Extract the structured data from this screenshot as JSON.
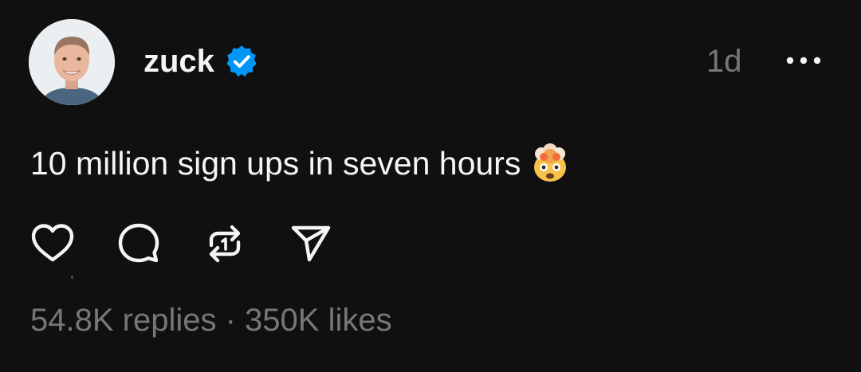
{
  "post": {
    "author": {
      "username": "zuck",
      "verified_icon": "verified-badge-icon",
      "avatar": "profile-photo"
    },
    "timestamp": "1d",
    "more_icon": "more-horizontal-icon",
    "text": "10 million sign ups in seven hours",
    "emoji": "exploding-head-emoji",
    "actions": [
      {
        "icon": "heart-icon"
      },
      {
        "icon": "comment-icon"
      },
      {
        "icon": "repost-icon"
      },
      {
        "icon": "share-send-icon"
      }
    ],
    "stats": {
      "replies": "54.8K replies",
      "separator": " · ",
      "likes": "350K likes"
    }
  },
  "colors": {
    "background": "#101010",
    "primary_text": "#f3f5f7",
    "secondary_text": "#777777",
    "verified_blue": "#0095f6"
  }
}
